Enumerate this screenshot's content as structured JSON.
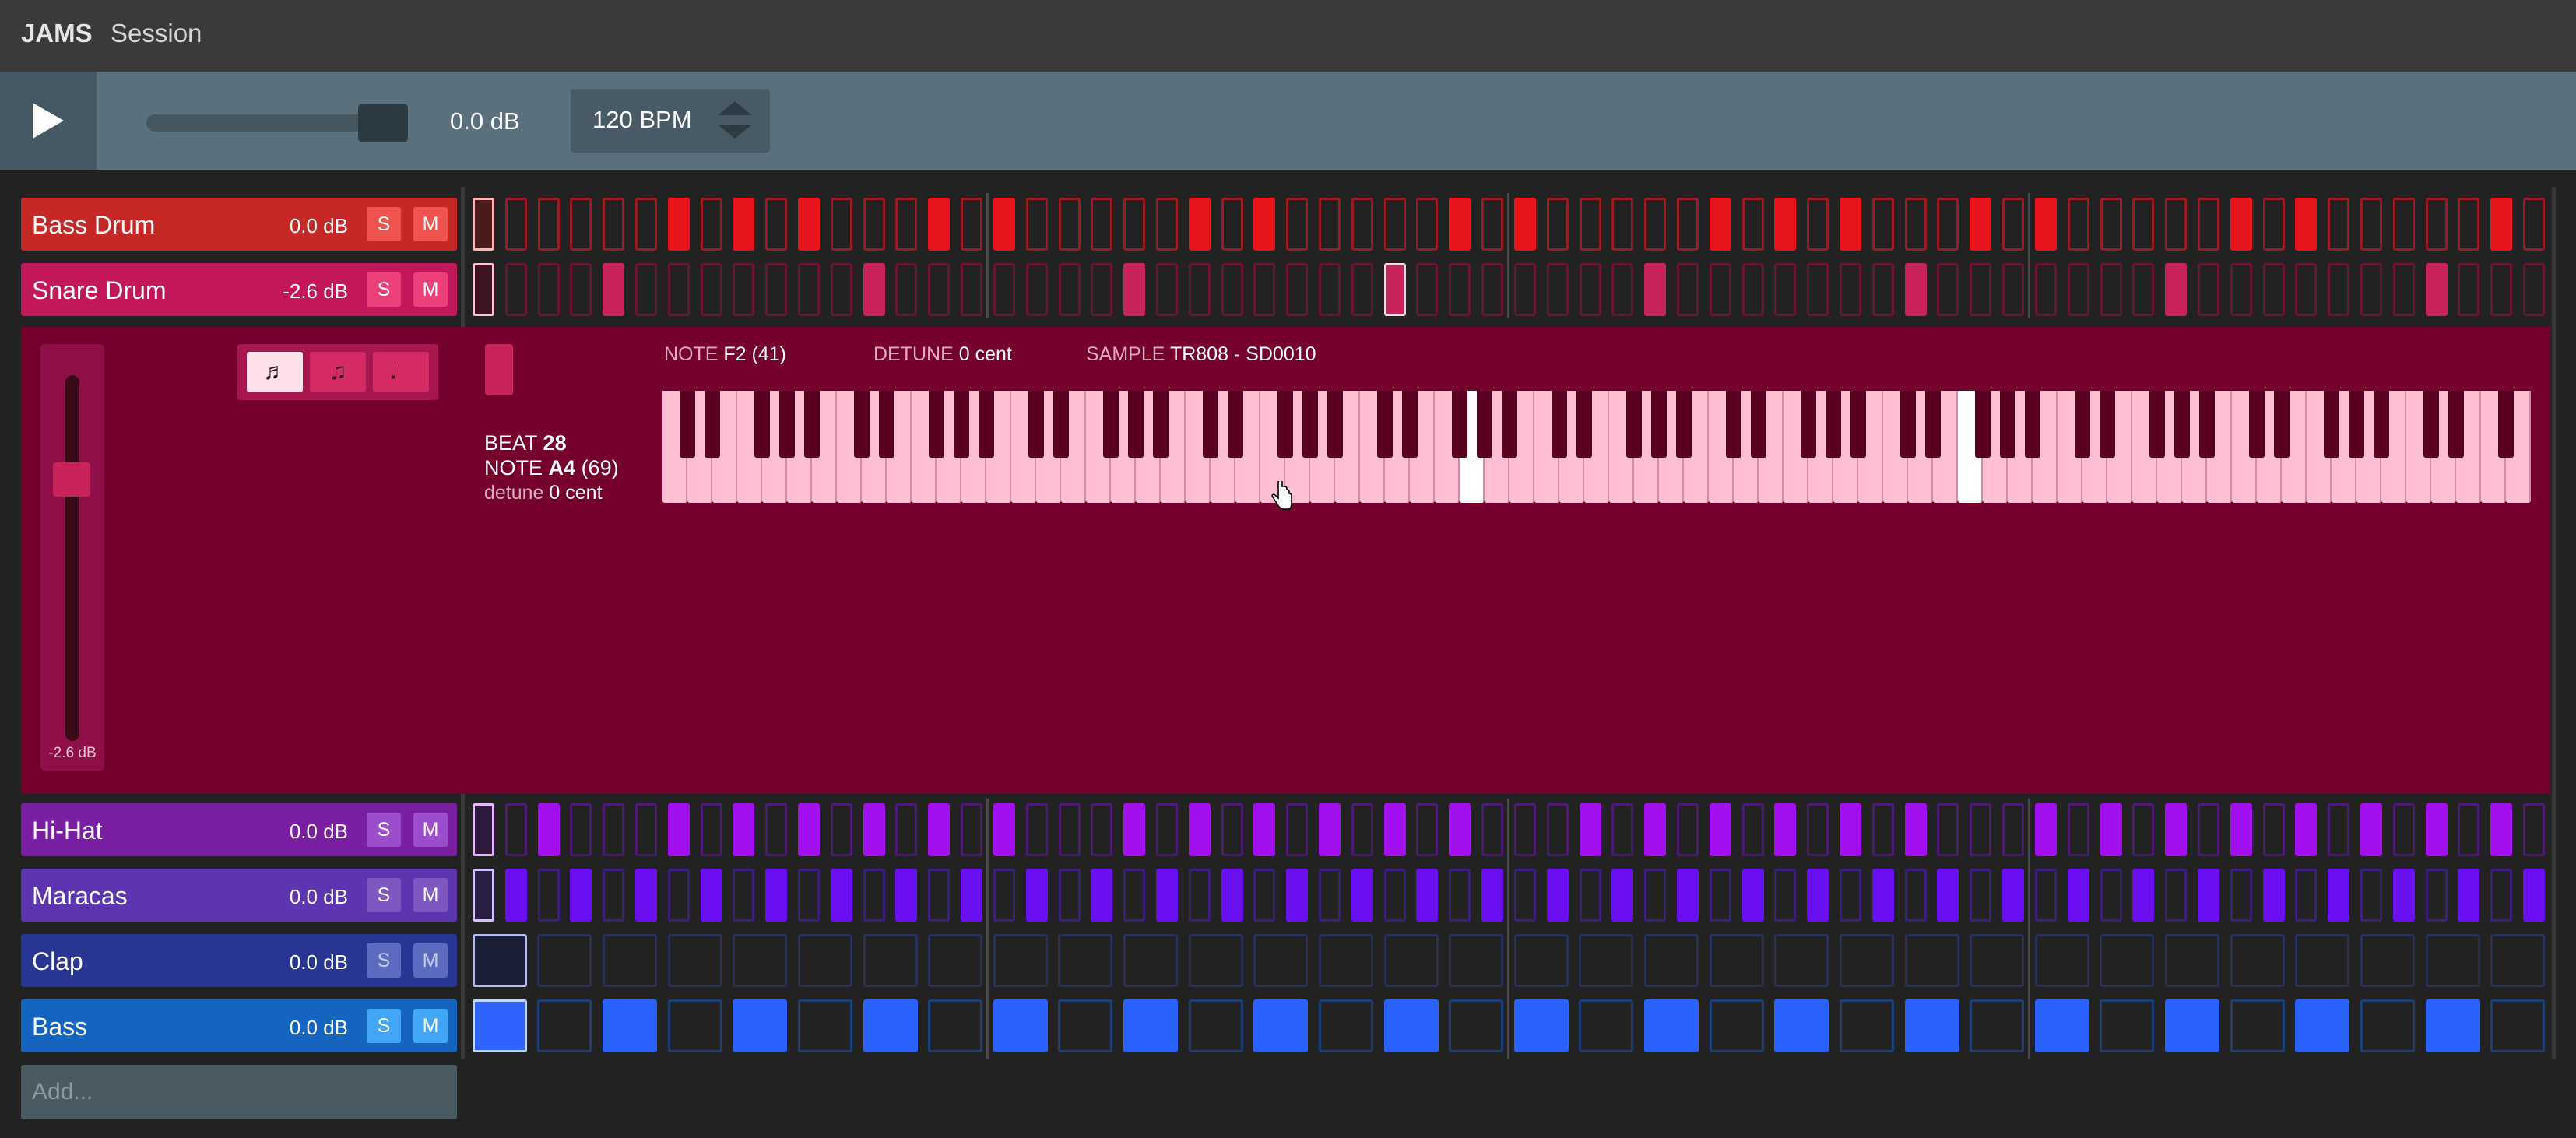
{
  "app": {
    "name": "JAMS",
    "menu": [
      "Session"
    ]
  },
  "transport": {
    "master_volume_label": "0.0 dB",
    "master_volume_level": 0.84,
    "bpm_label": "120 BPM"
  },
  "tracks": [
    {
      "name": "Bass Drum",
      "db": "0.0 dB",
      "solo": "S",
      "mute": "M",
      "header_bg": "#c62828",
      "btn_bg": "#ef5350",
      "btn_fg": "#ffffff",
      "on_color": "#e8141c",
      "off_border": "#9a1c22",
      "playhead_border": "#ffb3b3",
      "playhead_fill": "#4a1a1c",
      "steps": [
        1,
        0,
        0,
        0,
        0,
        0,
        1,
        0,
        1,
        0,
        1,
        0,
        0,
        0,
        1,
        0,
        1,
        0,
        0,
        0,
        0,
        0,
        1,
        0,
        1,
        0,
        0,
        0,
        0,
        0,
        1,
        0,
        1,
        0,
        0,
        0,
        0,
        0,
        1,
        0,
        1,
        0,
        1,
        0,
        0,
        0,
        1,
        0,
        1,
        0,
        0,
        0,
        0,
        0,
        1,
        0,
        1,
        0,
        0,
        0,
        0,
        0,
        1,
        0
      ]
    },
    {
      "name": "Snare Drum",
      "db": "-2.6 dB",
      "solo": "S",
      "mute": "M",
      "header_bg": "#c2185b",
      "btn_bg": "#ec407a",
      "btn_fg": "#ffffff",
      "on_color": "#c8235b",
      "off_border": "#6a1534",
      "playhead_border": "#ffc1d8",
      "playhead_fill": "#3e1424",
      "selected_step": 28,
      "selected_border": "#ffd6e3",
      "steps": [
        0,
        0,
        0,
        0,
        1,
        0,
        0,
        0,
        0,
        0,
        0,
        0,
        1,
        0,
        0,
        0,
        0,
        0,
        0,
        0,
        1,
        0,
        0,
        0,
        0,
        0,
        0,
        0,
        1,
        0,
        0,
        0,
        0,
        0,
        0,
        0,
        1,
        0,
        0,
        0,
        0,
        0,
        0,
        0,
        1,
        0,
        0,
        0,
        0,
        0,
        0,
        0,
        1,
        0,
        0,
        0,
        0,
        0,
        0,
        0,
        1,
        0,
        0,
        0
      ]
    },
    {
      "name": "Hi-Hat",
      "db": "0.0 dB",
      "solo": "S",
      "mute": "M",
      "header_bg": "#7b1fa2",
      "btn_bg": "#9c4dcc",
      "btn_fg": "#ffffff",
      "on_color": "#a40ff0",
      "off_border": "#4e1a78",
      "playhead_border": "#e8b8ff",
      "playhead_fill": "#2e1a3e",
      "steps": [
        0,
        0,
        1,
        0,
        0,
        0,
        1,
        0,
        1,
        0,
        1,
        0,
        1,
        0,
        1,
        0,
        1,
        0,
        0,
        0,
        1,
        0,
        1,
        0,
        1,
        0,
        1,
        0,
        1,
        0,
        1,
        0,
        0,
        0,
        1,
        0,
        1,
        0,
        1,
        0,
        1,
        0,
        1,
        0,
        1,
        0,
        0,
        0,
        1,
        0,
        1,
        0,
        1,
        0,
        1,
        0,
        1,
        0,
        1,
        0,
        1,
        0,
        1,
        0
      ]
    },
    {
      "name": "Maracas",
      "db": "0.0 dB",
      "solo": "S",
      "mute": "M",
      "header_bg": "#5e35b1",
      "btn_bg": "#7e57c2",
      "btn_fg": "#ffffff",
      "on_color": "#6a0ff0",
      "off_border": "#3b1f7a",
      "playhead_border": "#d4c2ff",
      "playhead_fill": "#2a1e44",
      "steps": [
        0,
        1,
        0,
        1,
        0,
        1,
        0,
        1,
        0,
        1,
        0,
        1,
        0,
        1,
        0,
        1,
        0,
        1,
        0,
        1,
        0,
        1,
        0,
        1,
        0,
        1,
        0,
        1,
        0,
        1,
        0,
        1,
        0,
        1,
        0,
        1,
        0,
        1,
        0,
        1,
        0,
        1,
        0,
        1,
        0,
        1,
        0,
        1,
        0,
        1,
        0,
        1,
        0,
        1,
        0,
        1,
        0,
        1,
        0,
        1,
        0,
        1,
        0,
        1
      ]
    },
    {
      "name": "Clap",
      "db": "0.0 dB",
      "solo": "S",
      "mute": "M",
      "header_bg": "#283593",
      "btn_bg": "#5c6bc0",
      "btn_fg": "#c5cae9",
      "on_color": "#3949ab",
      "off_border": "#283158",
      "playhead_border": "#b5bdf0",
      "playhead_fill": "#1c2036",
      "steps": [
        0,
        0,
        0,
        0,
        0,
        0,
        0,
        0,
        0,
        0,
        0,
        0,
        0,
        0,
        0,
        0,
        0,
        0,
        0,
        0,
        0,
        0,
        0,
        0,
        0,
        0,
        0,
        0,
        0,
        0,
        0,
        0
      ]
    },
    {
      "name": "Bass",
      "db": "0.0 dB",
      "solo": "S",
      "mute": "M",
      "header_bg": "#1565c0",
      "btn_bg": "#42a5f5",
      "btn_fg": "#ffffff",
      "on_color": "#2962ff",
      "off_border": "#1c3f78",
      "playhead_border": "#c0d8ff",
      "playhead_fill": "#2f63ff",
      "steps": [
        1,
        0,
        1,
        0,
        1,
        0,
        1,
        0,
        1,
        0,
        1,
        0,
        1,
        0,
        1,
        0,
        1,
        0,
        1,
        0,
        1,
        0,
        1,
        0,
        1,
        0,
        1,
        0,
        1,
        0,
        1,
        0
      ]
    }
  ],
  "editor": {
    "track": "Snare Drum",
    "fader_db": "-2.6 dB",
    "fader_level": 0.75,
    "mode_icons": [
      "beamed-eighth-notes-icon",
      "beamed-sixteenth-notes-icon",
      "quarter-note-icon"
    ],
    "mode_glyphs": [
      "♬",
      "♫",
      "♩"
    ],
    "note_label": "NOTE",
    "note_value": "F2 (41)",
    "detune_label": "DETUNE",
    "detune_value": "0 cent",
    "sample_label": "SAMPLE",
    "sample_value": "TR808 - SD0010",
    "beat_label": "BEAT",
    "beat_value": "28",
    "beat_note_label": "NOTE",
    "beat_note_value": "A4",
    "beat_note_number": "(69)",
    "beat_detune_label": "detune",
    "beat_detune_value": "0 cent",
    "keyboard": {
      "white_keys": 75,
      "highlighted_white_keys": [
        32,
        52
      ]
    }
  },
  "add_track": {
    "placeholder": "Add..."
  }
}
